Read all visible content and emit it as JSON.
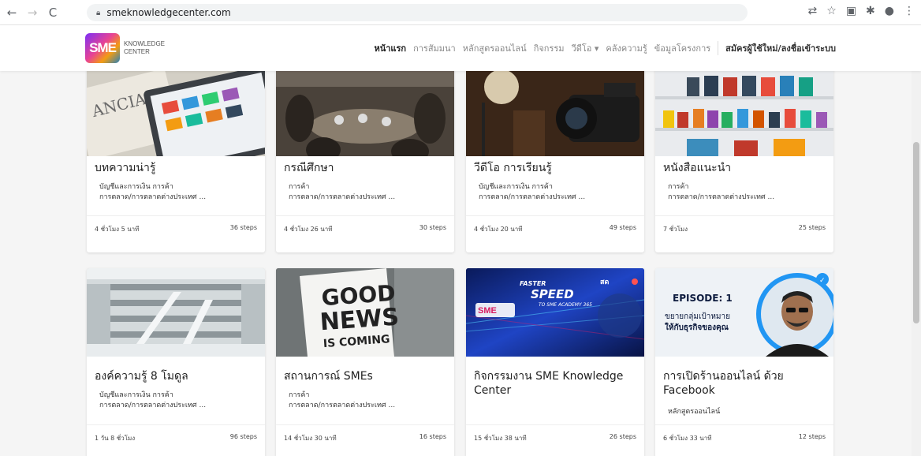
{
  "browser": {
    "url": "smeknowledgecenter.com"
  },
  "header": {
    "logo_mark": "SME",
    "logo_text_line1": "KNOWLEDGE",
    "logo_text_line2": "CENTER",
    "nav": [
      "หน้าแรก",
      "การสัมมนา",
      "หลักสูตรออนไลน์",
      "กิจกรรม",
      "วีดีโอ ▾",
      "คลังความรู้",
      "ข้อมูลโครงการ"
    ],
    "login": "สมัครผู้ใช้ใหม่/ลงชื่อเข้าระบบ"
  },
  "cards": [
    {
      "title": "บทความน่ารู้",
      "tag1": "บัญชีและการเงิน  การค้า",
      "tag2": "การตลาด/การตลาดต่างประเทศ ...",
      "duration": "4 ชั่วโมง 5 นาที",
      "steps": "36 steps",
      "image": "newspaper-tablet-image"
    },
    {
      "title": "กรณีศึกษา",
      "tag1": "การค้า",
      "tag2": "การตลาด/การตลาดต่างประเทศ ...",
      "duration": "4 ชั่วโมง 26 นาที",
      "steps": "30 steps",
      "image": "cafe-meeting-image"
    },
    {
      "title": "วีดีโอ การเรียนรู้",
      "tag1": "บัญชีและการเงิน  การค้า",
      "tag2": "การตลาด/การตลาดต่างประเทศ ...",
      "duration": "4 ชั่วโมง 20 นาที",
      "steps": "49 steps",
      "image": "video-camera-image"
    },
    {
      "title": "หนังสือแนะนำ",
      "tag1": "การค้า",
      "tag2": "การตลาด/การตลาดต่างประเทศ ...",
      "duration": "7 ชั่วโมง",
      "steps": "25 steps",
      "image": "bookshelf-image"
    },
    {
      "title": "องค์ความรู้ 8 โมดูล",
      "tag1": "บัญชีและการเงิน  การค้า",
      "tag2": "การตลาด/การตลาดต่างประเทศ ...",
      "duration": "1 วัน 8 ชั่วโมง",
      "steps": "96 steps",
      "image": "library-atrium-image"
    },
    {
      "title": "สถานการณ์ SMEs",
      "tag1": "การค้า",
      "tag2": "การตลาด/การตลาดต่างประเทศ ...",
      "duration": "14 ชั่วโมง 30 นาที",
      "steps": "16 steps",
      "image": "good-news-sign-image"
    },
    {
      "title": "กิจกรรมงาน SME Knowledge Center",
      "tag1": "",
      "tag2": "",
      "duration": "15 ชั่วโมง 38 นาที",
      "steps": "26 steps",
      "image": "sme-academy-banner-image"
    },
    {
      "title": "การเปิดร้านออนไลน์ ด้วย Facebook",
      "tag1": "หลักสูตรออนไลน์",
      "tag2": "",
      "duration": "6 ชั่วโมง 33 นาที",
      "steps": "12 steps",
      "image": "episode-banner-image"
    }
  ],
  "banner_good_news": {
    "line1": "GOOD",
    "line2": "NEWS",
    "line3": "IS COMING"
  },
  "banner_sme": {
    "faster": "FASTER",
    "speed": "SPEED",
    "academy": "TO SME ACADEMY 365",
    "live": "สด"
  },
  "banner_episode": {
    "episode": "EPISODE: 1",
    "sub1": "ขยายกลุ่มเป้าหมาย",
    "sub2": "ให้กับธุรกิจของคุณ"
  }
}
